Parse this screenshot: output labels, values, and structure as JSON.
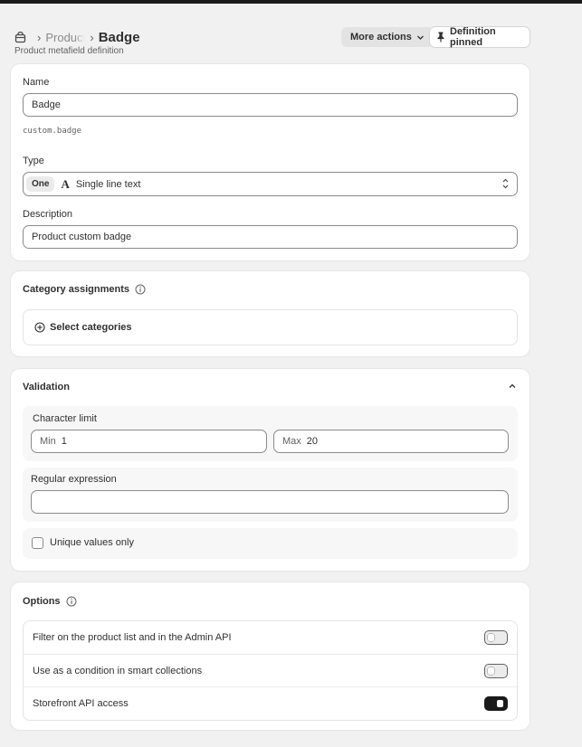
{
  "breadcrumb": {
    "parent": "Products",
    "current": "Badge"
  },
  "subtitle": "Product metafield definition",
  "actions": {
    "more_actions": "More actions",
    "pinned": "Definition pinned"
  },
  "definition": {
    "name_label": "Name",
    "name_value": "Badge",
    "namespace_key": "custom.badge",
    "type_label": "Type",
    "type_chip": "One",
    "type_glyph": "A",
    "type_value": "Single line text",
    "description_label": "Description",
    "description_value": "Product custom badge"
  },
  "category": {
    "title": "Category assignments",
    "select_label": "Select categories"
  },
  "validation": {
    "title": "Validation",
    "char_limit_label": "Character limit",
    "min_prefix": "Min",
    "min_value": "1",
    "max_prefix": "Max",
    "max_value": "20",
    "regex_label": "Regular expression",
    "regex_value": "",
    "unique_label": "Unique values only",
    "unique_checked": false
  },
  "options": {
    "title": "Options",
    "items": [
      {
        "label": "Filter on the product list and in the Admin API",
        "enabled": false
      },
      {
        "label": "Use as a condition in smart collections",
        "enabled": false
      },
      {
        "label": "Storefront API access",
        "enabled": true
      }
    ]
  },
  "colors": {
    "primary_text": "#303030",
    "toggle_on": "#1a1a1a",
    "page_bg": "#f1f1f1"
  }
}
